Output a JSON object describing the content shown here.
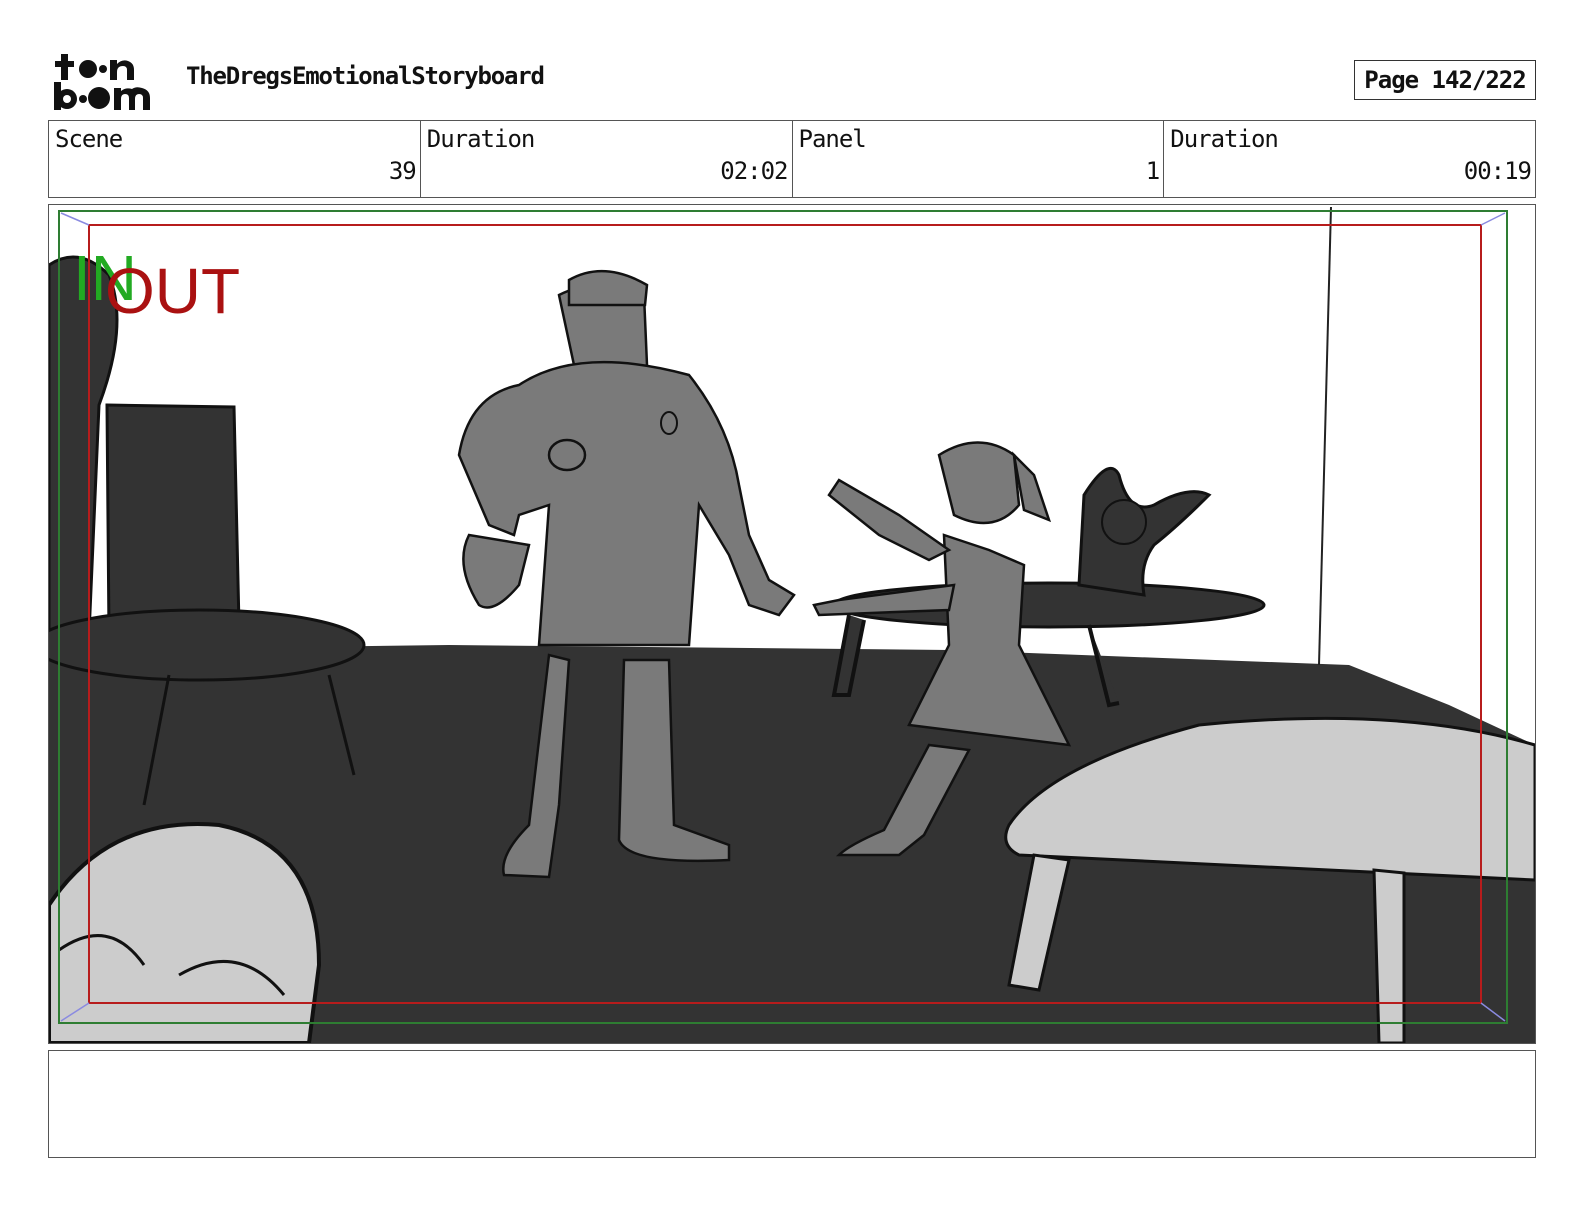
{
  "header": {
    "logo_text": "toon boom",
    "project_title": "TheDregsEmotionalStoryboard",
    "page_label": "Page 142/222"
  },
  "info": {
    "scene_label": "Scene",
    "scene_value": "39",
    "scene_duration_label": "Duration",
    "scene_duration_value": "02:02",
    "panel_label": "Panel",
    "panel_value": "1",
    "panel_duration_label": "Duration",
    "panel_duration_value": "00:19"
  },
  "panel": {
    "in_marker": "IN",
    "out_marker": "OUT",
    "colors": {
      "in_marker": "#22aa22",
      "out_marker": "#aa1111",
      "floor": "#333333",
      "figure": "#7a7a7a",
      "furniture_light": "#cccccc"
    }
  },
  "notes": {
    "text": ""
  }
}
